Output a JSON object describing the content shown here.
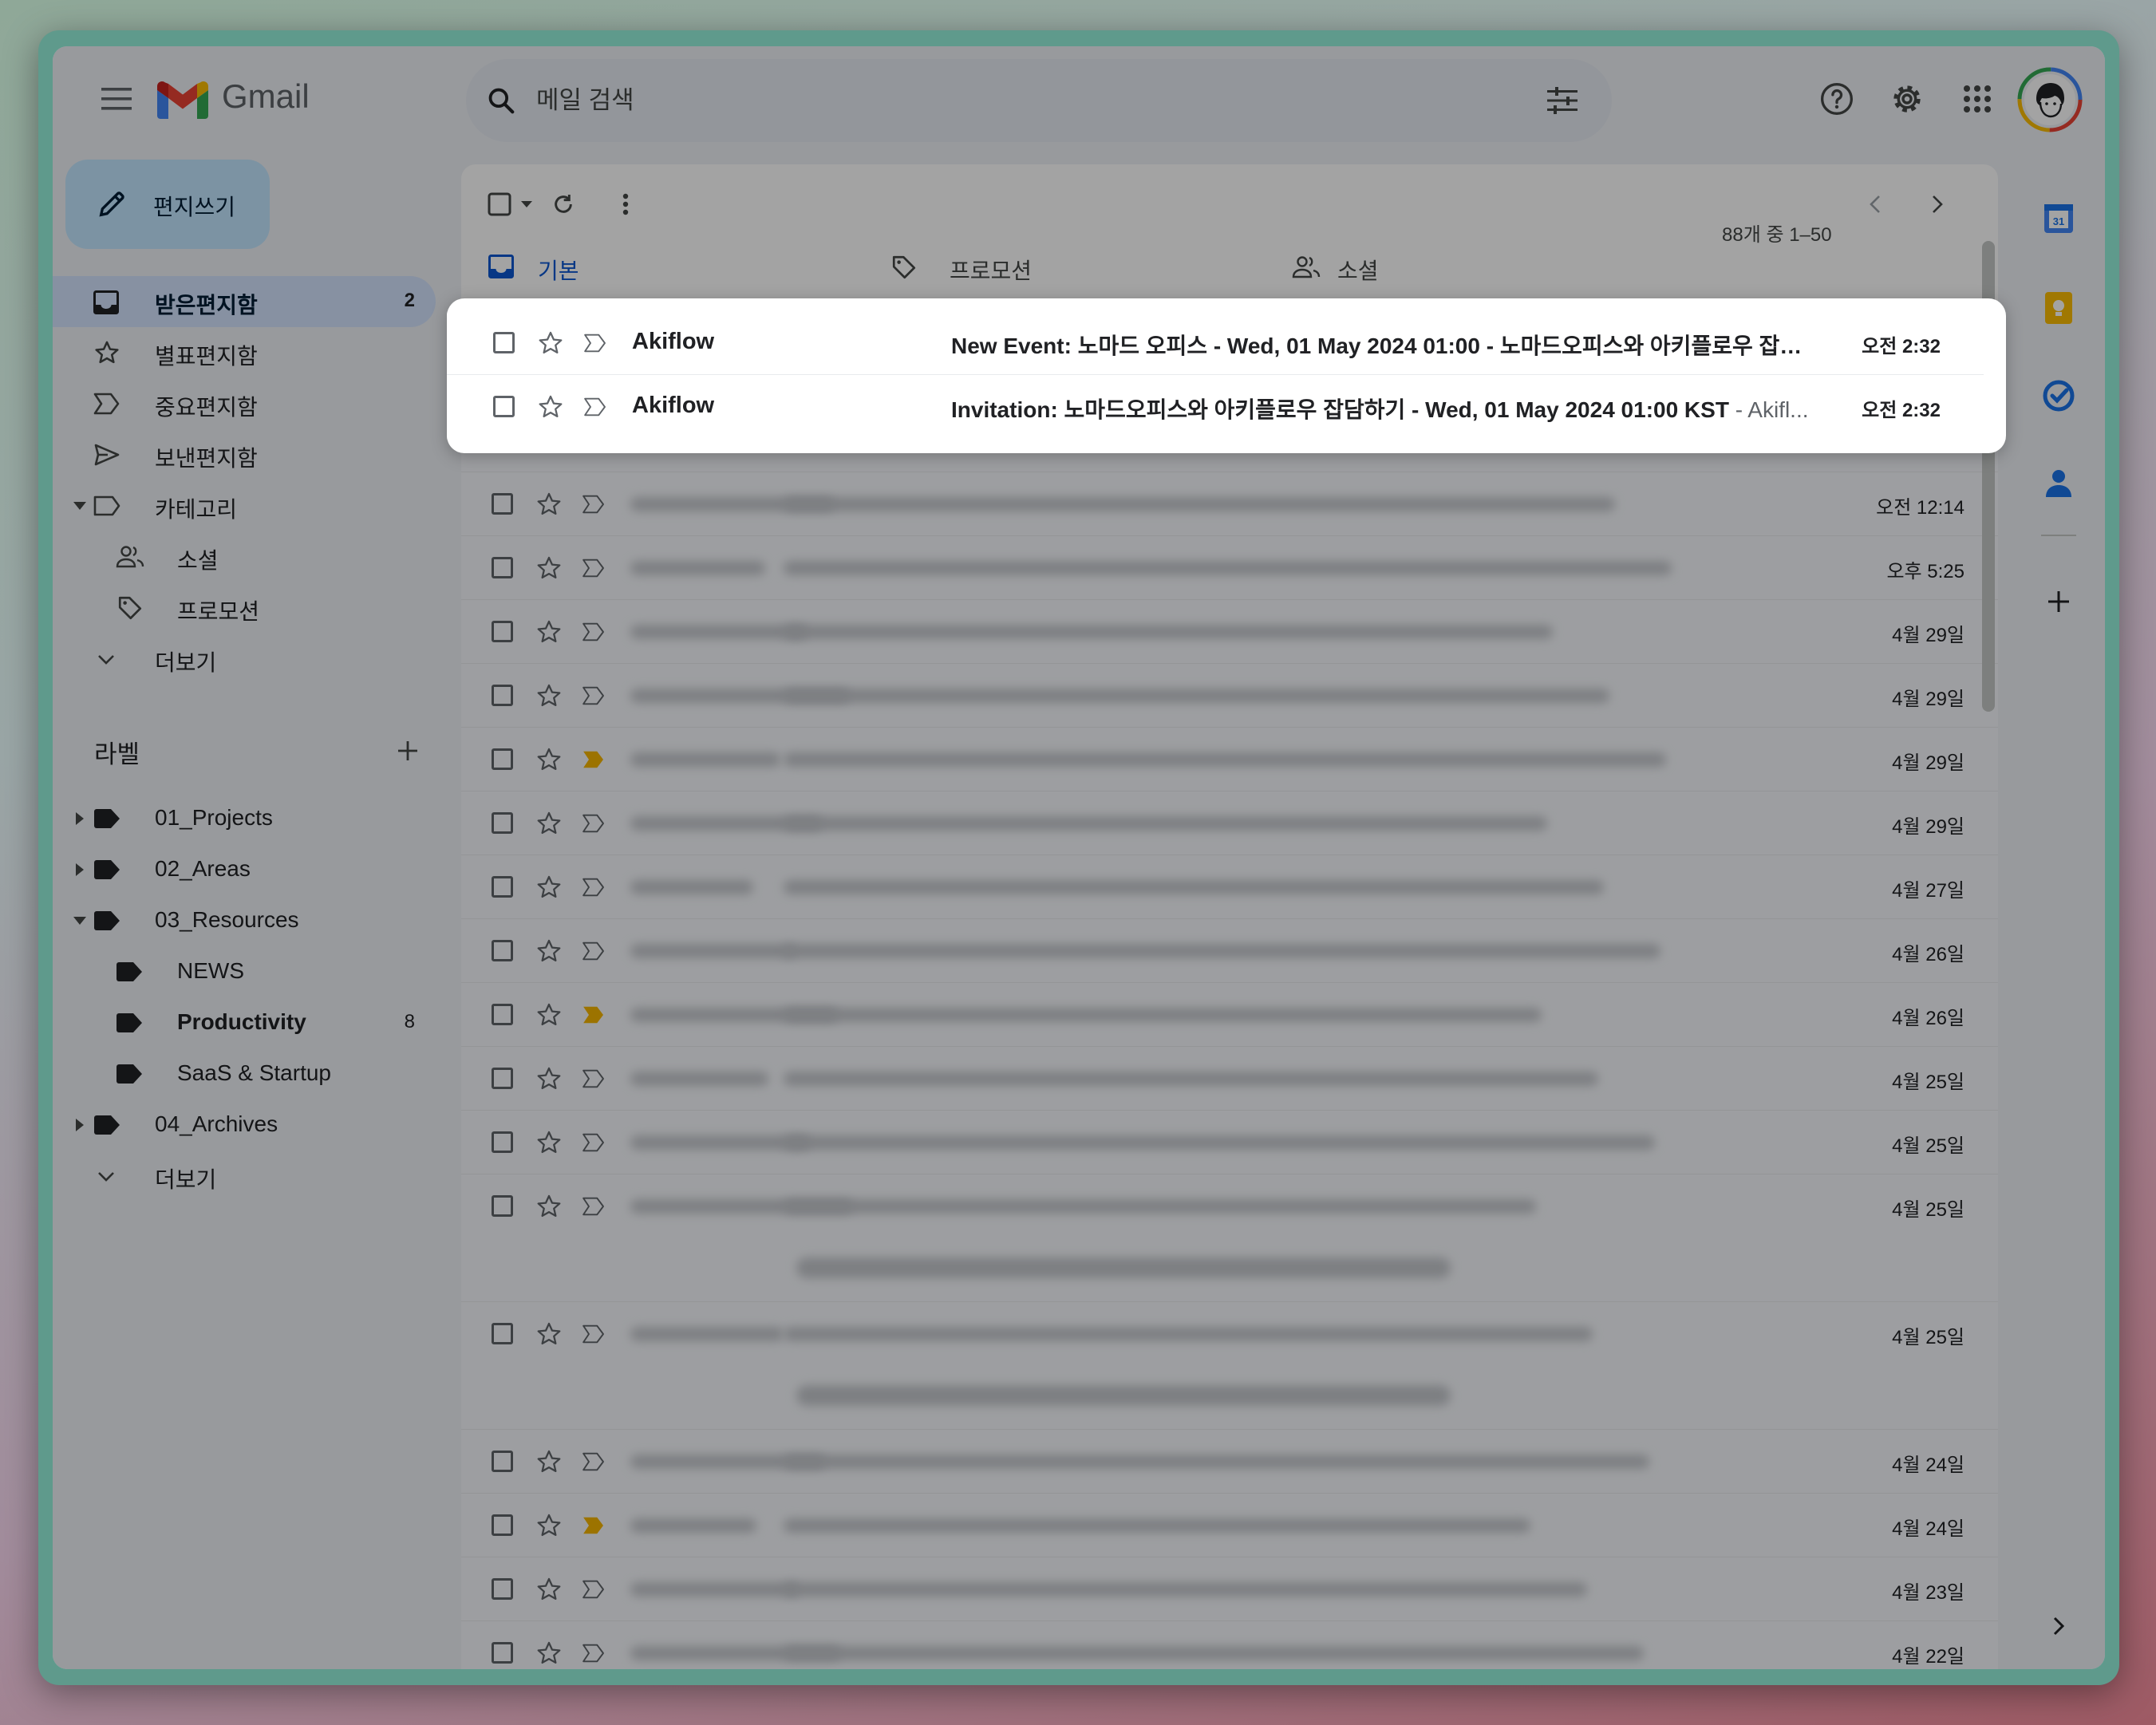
{
  "header": {
    "app_name": "Gmail",
    "search_placeholder": "메일 검색"
  },
  "compose": {
    "label": "편지쓰기"
  },
  "sidebar": {
    "items": [
      {
        "label": "받은편지함",
        "count": "2"
      },
      {
        "label": "별표편지함"
      },
      {
        "label": "중요편지함"
      },
      {
        "label": "보낸편지함"
      },
      {
        "label": "카테고리"
      },
      {
        "label": "소셜"
      },
      {
        "label": "프로모션"
      },
      {
        "label": "더보기"
      }
    ],
    "labels_title": "라벨",
    "labels": [
      {
        "label": "01_Projects"
      },
      {
        "label": "02_Areas"
      },
      {
        "label": "03_Resources"
      },
      {
        "label": "NEWS"
      },
      {
        "label": "Productivity",
        "count": "8"
      },
      {
        "label": "SaaS & Startup"
      },
      {
        "label": "04_Archives"
      },
      {
        "label": "더보기"
      }
    ]
  },
  "toolbar": {
    "pagination": "88개 중 1–50"
  },
  "tabs": [
    {
      "label": "기본"
    },
    {
      "label": "프로모션"
    },
    {
      "label": "소셜"
    }
  ],
  "emails_highlighted": [
    {
      "sender": "Akiflow",
      "subject": "New Event: 노마드 오피스 - Wed, 01 May 2024 01:00 - 노마드오피스와 아키플로우 잡담...",
      "preview": "",
      "date": "오전 2:32"
    },
    {
      "sender": "Akiflow",
      "subject": "Invitation: 노마드오피스와 아키플로우 잡담하기 - Wed, 01 May 2024 01:00 KST",
      "preview": " - Akifl...",
      "date": "오전 2:32"
    }
  ],
  "emails_dates": [
    "오전 12:14",
    "오후 5:25",
    "4월 29일",
    "4월 29일",
    "4월 29일",
    "4월 29일",
    "4월 27일",
    "4월 26일",
    "4월 26일",
    "4월 25일",
    "4월 25일",
    "4월 25일",
    "4월 25일",
    "4월 24일",
    "4월 24일",
    "4월 23일",
    "4월 22일"
  ],
  "colors": {
    "accent": "#0b57d0",
    "compose_bg": "#c2e7ff",
    "active_nav": "#d3e3fd",
    "app_bg": "#eef1f6",
    "important_marker": "#f4b400"
  },
  "icons": [
    "menu-icon",
    "gmail-logo-icon",
    "search-icon",
    "search-options-icon",
    "help-icon",
    "settings-icon",
    "apps-icon",
    "avatar",
    "pencil-icon",
    "inbox-icon",
    "star-icon",
    "important-icon",
    "send-icon",
    "label-icon",
    "people-icon",
    "tag-icon",
    "chevron-down-icon",
    "plus-icon",
    "refresh-icon",
    "more-vert-icon",
    "chevron-left-icon",
    "chevron-right-icon",
    "calendar-icon",
    "keep-icon",
    "tasks-icon",
    "contacts-icon"
  ]
}
